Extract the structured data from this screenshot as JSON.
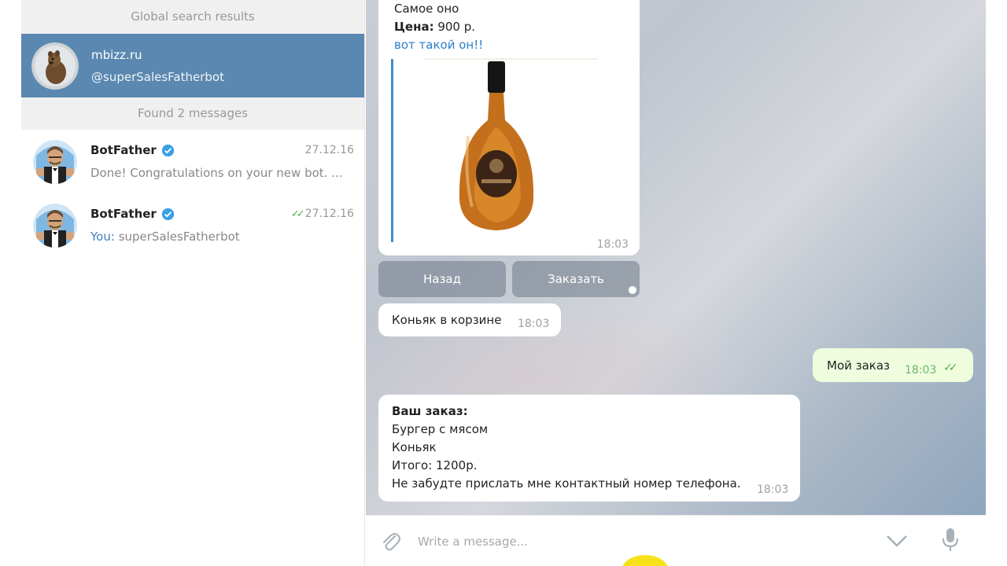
{
  "sidebar": {
    "global_header": "Global search results",
    "selected_result": {
      "name": "mbizz.ru",
      "handle": "@superSalesFatherbot"
    },
    "found_header": "Found 2 messages",
    "messages": [
      {
        "name": "BotFather",
        "date": "27.12.16",
        "checks": "",
        "preview_you": "",
        "preview": "Done! Congratulations on your new bot. ..."
      },
      {
        "name": "BotFather",
        "date": "27.12.16",
        "checks": "✓✓",
        "preview_you": "You: ",
        "preview": "superSalesFatherbot"
      }
    ]
  },
  "chat": {
    "product": {
      "line1": "Самое оно",
      "price_label": "Цена:",
      "price_value": " 900 р.",
      "link": "вот такой он!!",
      "time": "18:03"
    },
    "keyboard": {
      "back": "Назад",
      "order": "Заказать"
    },
    "cart": {
      "text": "Коньяк в корзине",
      "time": "18:03"
    },
    "outgoing": {
      "text": "Мой заказ",
      "time": "18:03",
      "checks": "✓✓"
    },
    "order": {
      "title": "Ваш заказ:",
      "lines": [
        "Бургер с мясом",
        "Коньяк",
        "Итого: 1200р.",
        "Не забудте прислать мне контактный номер телефона."
      ],
      "time": "18:03"
    }
  },
  "composer": {
    "placeholder": "Write a message..."
  },
  "colors": {
    "selected": "#5b88b0",
    "link": "#2d7ec7",
    "outgoing": "#effdde",
    "check": "#4fae4e"
  }
}
